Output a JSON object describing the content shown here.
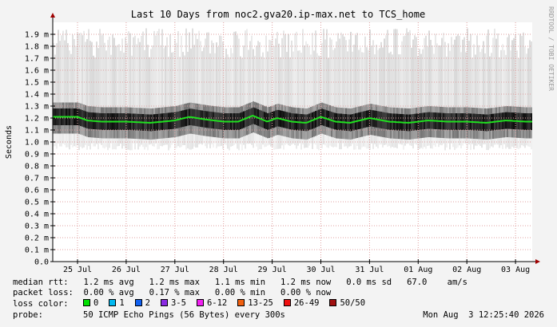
{
  "chart_data": {
    "type": "area",
    "title": "Last 10 Days from noc2.gva20.ip-max.net to TCS_home",
    "side_label": "RRDTOOL / TOBI OETIKER",
    "ylabel": "Seconds",
    "ylim": [
      0,
      2.0
    ],
    "y_ticks": [
      "0.0",
      "0.1 m",
      "0.2 m",
      "0.3 m",
      "0.4 m",
      "0.5 m",
      "0.6 m",
      "0.7 m",
      "0.8 m",
      "0.9 m",
      "1.0 m",
      "1.1 m",
      "1.2 m",
      "1.3 m",
      "1.4 m",
      "1.5 m",
      "1.6 m",
      "1.7 m",
      "1.8 m",
      "1.9 m"
    ],
    "x_ticks": [
      "25 Jul",
      "26 Jul",
      "27 Jul",
      "28 Jul",
      "29 Jul",
      "30 Jul",
      "31 Jul",
      "01 Aug",
      "02 Aug",
      "03 Aug"
    ],
    "grid": true,
    "median_series": {
      "name": "median rtt",
      "x_days": [
        0,
        0.2,
        0.5,
        1.0,
        1.5,
        2.0,
        2.3,
        2.6,
        3.0,
        3.3,
        3.6,
        3.9,
        4.1,
        4.4,
        4.7,
        5.0,
        5.3,
        5.6,
        6.0,
        6.4,
        6.8,
        7.2,
        7.6,
        8.0,
        8.4,
        8.8,
        9.2,
        9.5,
        9.7,
        9.9
      ],
      "values_ms": [
        1.21,
        1.18,
        1.17,
        1.17,
        1.16,
        1.18,
        1.21,
        1.19,
        1.17,
        1.17,
        1.22,
        1.17,
        1.2,
        1.17,
        1.16,
        1.21,
        1.17,
        1.16,
        1.2,
        1.17,
        1.16,
        1.18,
        1.17,
        1.17,
        1.16,
        1.18,
        1.17,
        1.17,
        1.21,
        1.21
      ]
    },
    "smoke_range_ms": [
      0.93,
      1.95
    ],
    "colors": {
      "median": "#20e020",
      "smoke_dark": "#2a2a2a",
      "grid": "#e0a0a0",
      "axis": "#000000"
    }
  },
  "stats": {
    "median_rtt": "median rtt:   1.2 ms avg   1.2 ms max   1.1 ms min   1.2 ms now   0.0 ms sd   67.0    am/s",
    "packet_loss": "packet loss:  0.00 % avg   0.17 % max   0.00 % min   0.00 % now",
    "loss_color_label": "loss color:",
    "probe_label": "probe:",
    "probe_text": "50 ICMP Echo Pings (56 Bytes) every 300s",
    "timestamp": "Mon Aug  3 12:25:40 2026"
  },
  "loss_legend": [
    {
      "label": "0",
      "color": "#00e000"
    },
    {
      "label": "1",
      "color": "#00b8f0"
    },
    {
      "label": "2",
      "color": "#1060f0"
    },
    {
      "label": "3-5",
      "color": "#8a2be2"
    },
    {
      "label": "6-12",
      "color": "#f020f0"
    },
    {
      "label": "13-25",
      "color": "#f06010"
    },
    {
      "label": "26-49",
      "color": "#f01010"
    },
    {
      "label": "50/50",
      "color": "#a01010"
    }
  ]
}
